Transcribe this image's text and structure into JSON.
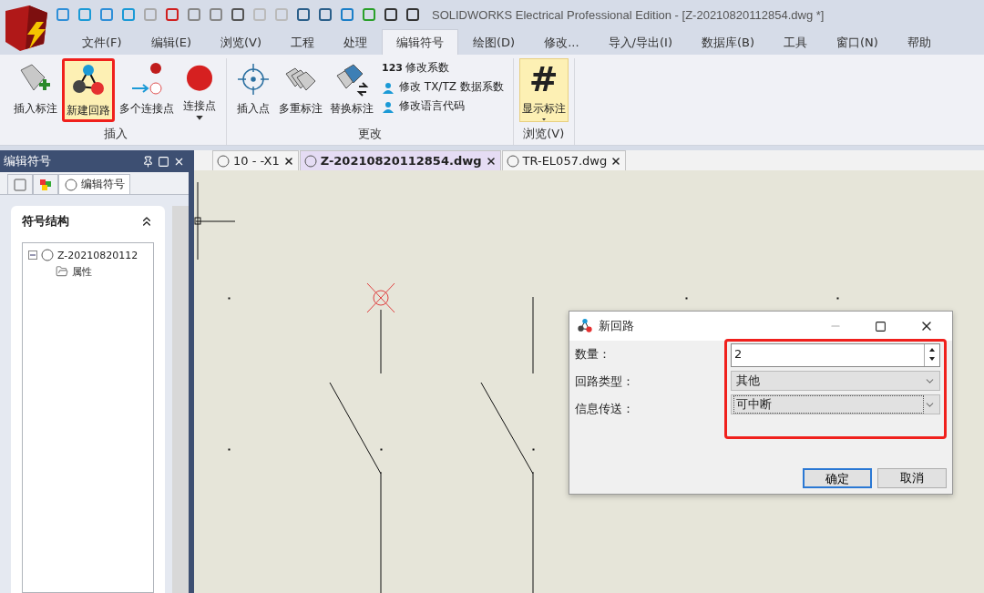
{
  "app": {
    "title": "SOLIDWORKS Electrical Professional Edition - [Z-20210820112854.dwg *]"
  },
  "menu": [
    {
      "label": "文件(F)",
      "selected": false
    },
    {
      "label": "编辑(E)",
      "selected": false
    },
    {
      "label": "浏览(V)",
      "selected": false
    },
    {
      "label": "工程",
      "selected": false
    },
    {
      "label": "处理",
      "selected": false
    },
    {
      "label": "编辑符号",
      "selected": true
    },
    {
      "label": "绘图(D)",
      "selected": false
    },
    {
      "label": "修改...",
      "selected": false
    },
    {
      "label": "导入/导出(I)",
      "selected": false
    },
    {
      "label": "数据库(B)",
      "selected": false
    },
    {
      "label": "工具",
      "selected": false
    },
    {
      "label": "窗口(N)",
      "selected": false
    },
    {
      "label": "帮助",
      "selected": false
    }
  ],
  "ribbon": {
    "groups": [
      {
        "label": "插入",
        "buttons": [
          {
            "label": "插入标注",
            "highlighted": false,
            "dropdown": false
          },
          {
            "label": "新建回路",
            "highlighted": true,
            "dropdown": false
          },
          {
            "label": "多个连接点",
            "highlighted": false,
            "dropdown": false
          },
          {
            "label": "连接点",
            "highlighted": false,
            "dropdown": true
          }
        ]
      },
      {
        "label": "更改",
        "buttons": [
          {
            "label": "插入点",
            "highlighted": false,
            "dropdown": false
          },
          {
            "label": "多重标注",
            "highlighted": false,
            "dropdown": false
          },
          {
            "label": "替换标注",
            "highlighted": false,
            "dropdown": false
          }
        ],
        "small_items": [
          {
            "prefix": "123",
            "label": "修改系数"
          },
          {
            "label": "修改 TX/TZ 数据系数"
          },
          {
            "label": "修改语言代码"
          }
        ]
      },
      {
        "label": "浏览(V)",
        "buttons": [
          {
            "label": "显示标注",
            "glyph": "#",
            "highlighted": false,
            "selected": true,
            "dropdown": true
          }
        ]
      }
    ]
  },
  "panel": {
    "title": "编辑符号",
    "tabs": [
      {
        "selected": false
      },
      {
        "selected": false
      },
      {
        "label": "编辑符号",
        "selected": true
      }
    ],
    "section": "符号结构",
    "tree": [
      {
        "label": "Z-20210820112",
        "expanded": true,
        "children": [
          {
            "label": "属性"
          }
        ]
      }
    ]
  },
  "doc_tabs": [
    {
      "label": "10 - -X1",
      "selected": false
    },
    {
      "label": "Z-20210820112854.dwg",
      "selected": true
    },
    {
      "label": "TR-EL057.dwg",
      "selected": false
    }
  ],
  "dialog": {
    "title": "新回路",
    "highlighted": true,
    "fields": [
      {
        "kind": "spin",
        "label": "数量：",
        "value": "2"
      },
      {
        "kind": "select",
        "label": "回路类型：",
        "value": "其他",
        "focused": false
      },
      {
        "kind": "select",
        "label": "信息传送：",
        "value": "可中断",
        "focused": true
      }
    ],
    "buttons": [
      {
        "label": "确定",
        "default": true
      },
      {
        "label": "取消",
        "default": false
      }
    ]
  }
}
